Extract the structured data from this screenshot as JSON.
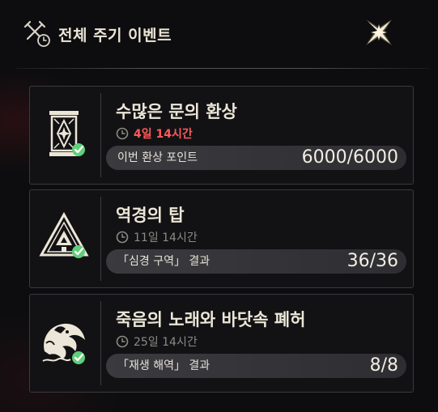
{
  "header": {
    "title": "전체 주기 이벤트",
    "icon": "crossed-swords-clock-icon",
    "close_icon": "close-star-icon"
  },
  "colors": {
    "timer_urgent": "#ff5a5a",
    "timer_normal": "#8d8a84",
    "check": "#5fcf7a",
    "emblem": "#ece6d8"
  },
  "events": [
    {
      "title": "수많은 문의 환상",
      "timer": "4일 14시간",
      "timer_urgent": true,
      "progress_label": "이번 환상 포인트",
      "progress_value": "6000/6000",
      "emblem_icon": "portal-frame-icon",
      "completed": true
    },
    {
      "title": "역경의 탑",
      "timer": "11일 14시간",
      "timer_urgent": false,
      "progress_label": "「심경 구역」 결과",
      "progress_value": "36/36",
      "emblem_icon": "tower-triangle-icon",
      "completed": true
    },
    {
      "title": "죽음의 노래와 바닷속 폐허",
      "timer": "25일 14시간",
      "timer_urgent": false,
      "progress_label": "「재생 해역」 결과",
      "progress_value": "8/8",
      "emblem_icon": "sea-serpent-icon",
      "completed": true
    }
  ]
}
